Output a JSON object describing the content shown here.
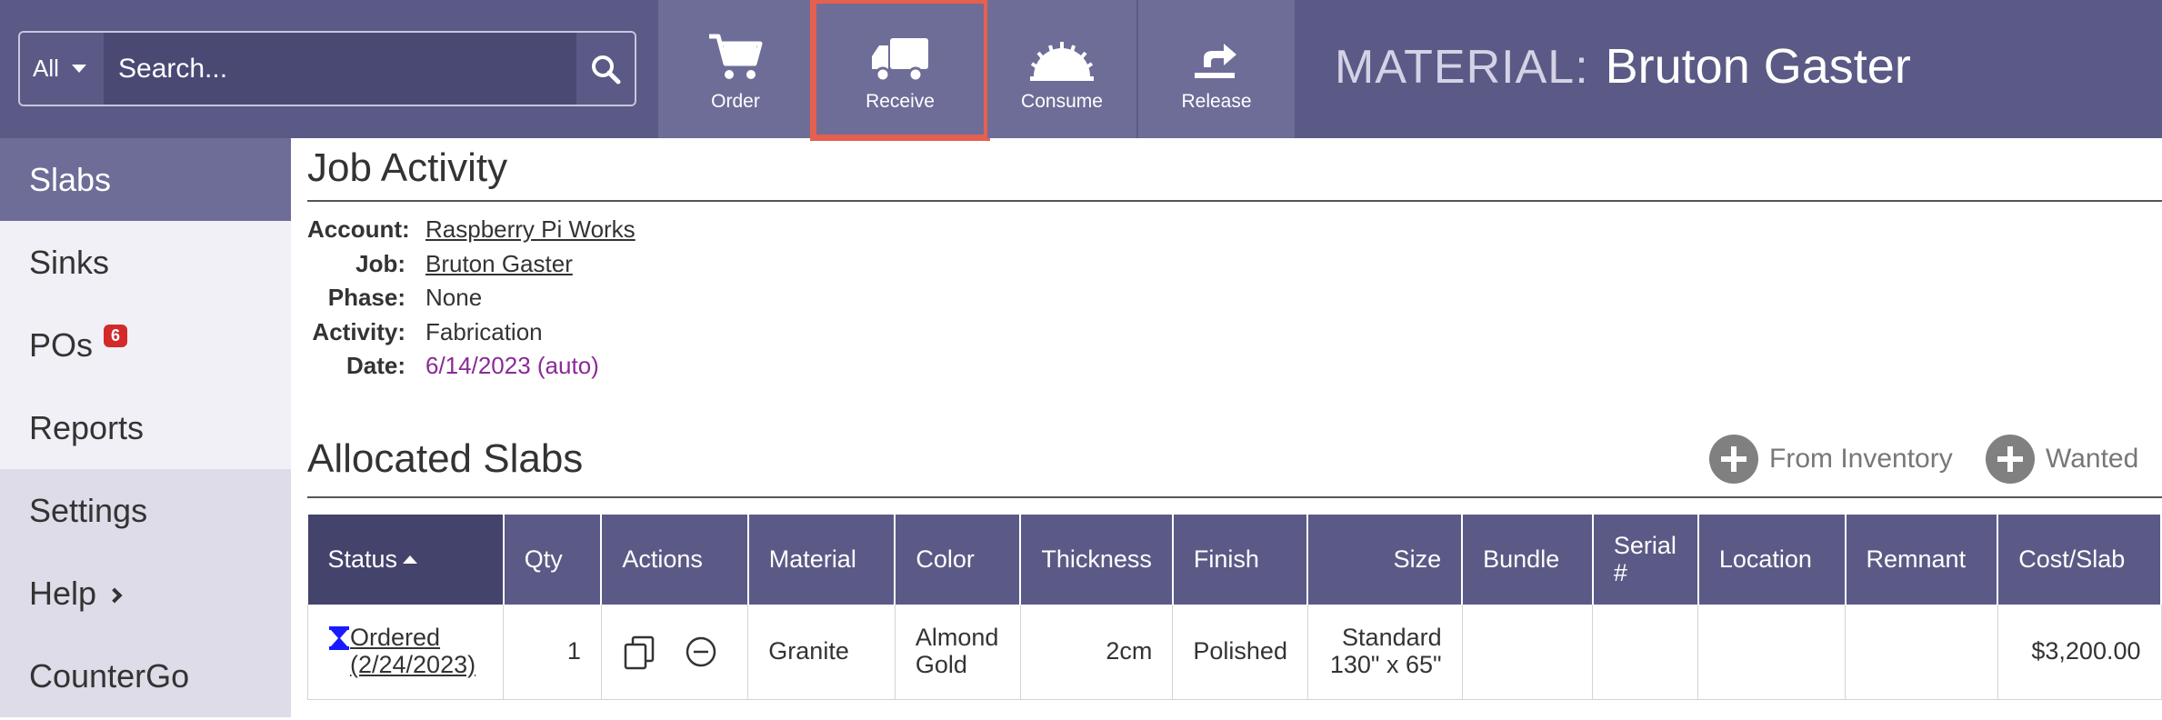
{
  "search": {
    "scope": "All",
    "placeholder": "Search..."
  },
  "toolbar": {
    "order_label": "Order",
    "receive_label": "Receive",
    "consume_label": "Consume",
    "release_label": "Release",
    "active": "Receive",
    "highlight_color": "#e5604f"
  },
  "material": {
    "label": "MATERIAL:",
    "name": "Bruton Gaster"
  },
  "sidebar": {
    "items": [
      {
        "label": "Slabs"
      },
      {
        "label": "Sinks"
      },
      {
        "label": "POs",
        "badge": "6"
      },
      {
        "label": "Reports"
      },
      {
        "label": "Settings"
      },
      {
        "label": "Help"
      },
      {
        "label": "CounterGo"
      }
    ]
  },
  "job_activity": {
    "title": "Job Activity",
    "fields": {
      "account": {
        "label": "Account:",
        "value": "Raspberry Pi Works"
      },
      "job": {
        "label": "Job:",
        "value": "Bruton Gaster"
      },
      "phase": {
        "label": "Phase:",
        "value": "None"
      },
      "activity": {
        "label": "Activity:",
        "value": "Fabrication"
      },
      "date": {
        "label": "Date:",
        "value": "6/14/2023 (auto)"
      }
    }
  },
  "allocated": {
    "title": "Allocated Slabs",
    "from_inventory_label": "From Inventory",
    "wanted_label": "Wanted",
    "columns": [
      "Status",
      "Qty",
      "Actions",
      "Material",
      "Color",
      "Thickness",
      "Finish",
      "Size",
      "Bundle",
      "Serial #",
      "Location",
      "Remnant",
      "Cost/Slab"
    ],
    "rows": [
      {
        "status_line1": "Ordered",
        "status_line2": "(2/24/2023)",
        "qty": "1",
        "material": "Granite",
        "color_line1": "Almond",
        "color_line2": "Gold",
        "thickness": "2cm",
        "finish": "Polished",
        "size_line1": "Standard",
        "size_line2": "130\" x 65\"",
        "bundle": "",
        "serial": "",
        "location": "",
        "remnant": "",
        "cost": "$3,200.00"
      }
    ]
  },
  "colors": {
    "header_bg": "#5b5a86",
    "tool_bg": "#6e6d98",
    "badge": "#d22a2a",
    "date_text": "#8a2a97",
    "hourglass": "#1a1aff"
  }
}
